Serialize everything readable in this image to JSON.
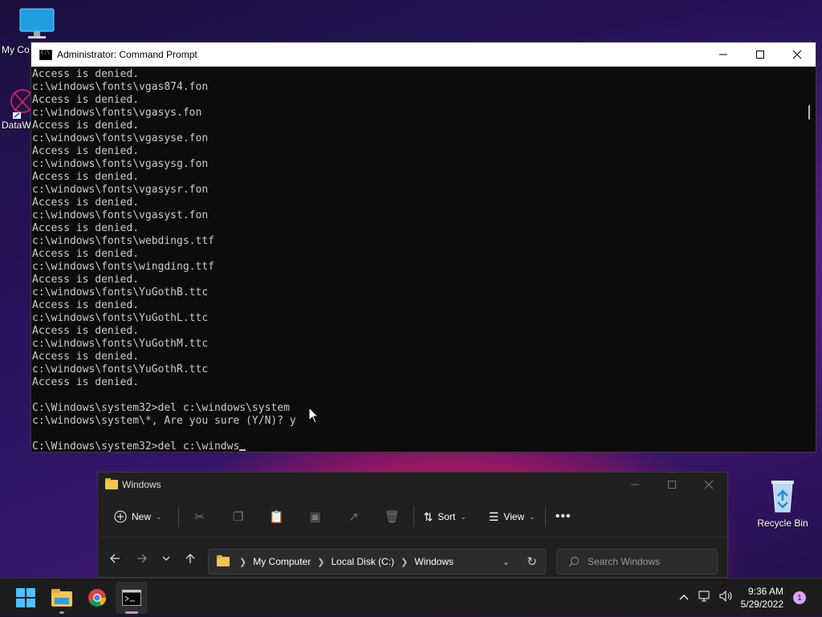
{
  "desktop": {
    "icons": [
      {
        "label": "My Computer",
        "shown": "My Co"
      },
      {
        "label": "DataW",
        "shown": "DataW"
      },
      {
        "label": "Recycle Bin",
        "shown": "Recycle Bin"
      }
    ]
  },
  "cmd": {
    "title": "Administrator: Command Prompt",
    "lines": [
      "Access is denied.",
      "c:\\windows\\fonts\\vgas874.fon",
      "Access is denied.",
      "c:\\windows\\fonts\\vgasys.fon",
      "Access is denied.",
      "c:\\windows\\fonts\\vgasyse.fon",
      "Access is denied.",
      "c:\\windows\\fonts\\vgasysg.fon",
      "Access is denied.",
      "c:\\windows\\fonts\\vgasysr.fon",
      "Access is denied.",
      "c:\\windows\\fonts\\vgasyst.fon",
      "Access is denied.",
      "c:\\windows\\fonts\\webdings.ttf",
      "Access is denied.",
      "c:\\windows\\fonts\\wingding.ttf",
      "Access is denied.",
      "c:\\windows\\fonts\\YuGothB.ttc",
      "Access is denied.",
      "c:\\windows\\fonts\\YuGothL.ttc",
      "Access is denied.",
      "c:\\windows\\fonts\\YuGothM.ttc",
      "Access is denied.",
      "c:\\windows\\fonts\\YuGothR.ttc",
      "Access is denied.",
      "",
      "C:\\Windows\\system32>del c:\\windows\\system",
      "c:\\windows\\system\\*, Are you sure (Y/N)? y",
      ""
    ],
    "prompt_line": "C:\\Windows\\system32>del c:\\windws"
  },
  "explorer": {
    "title": "Windows",
    "toolbar": {
      "new_label": "New",
      "sort_label": "Sort",
      "view_label": "View"
    },
    "address": [
      "My Computer",
      "Local Disk (C:)",
      "Windows"
    ],
    "search_placeholder": "Search Windows"
  },
  "taskbar": {
    "time": "9:36 AM",
    "date": "5/29/2022",
    "notifications": "1"
  }
}
